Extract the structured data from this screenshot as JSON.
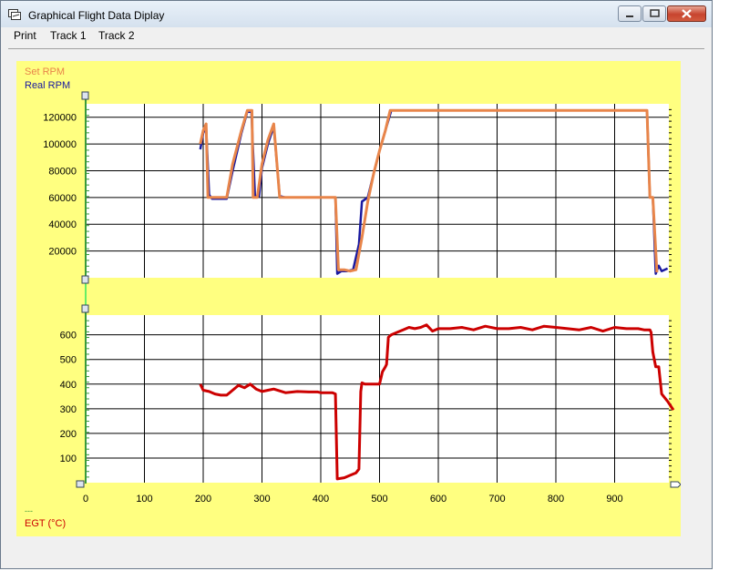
{
  "window": {
    "title": "Graphical Flight Data Diplay"
  },
  "menu": {
    "items": [
      "Print",
      "Track 1",
      "Track 2"
    ]
  },
  "legend": {
    "top": [
      {
        "label": "Set RPM",
        "color": "#e8854a"
      },
      {
        "label": "Real RPM",
        "color": "#1a1aa0"
      }
    ],
    "bottom": [
      {
        "label": "---",
        "color": "#3a9a3a"
      },
      {
        "label": "EGT (°C)",
        "color": "#cc0000"
      }
    ]
  },
  "chart_data": [
    {
      "type": "line",
      "x_range": [
        0,
        1000
      ],
      "ylim": [
        0,
        130000
      ],
      "y_ticks": [
        20000,
        40000,
        60000,
        80000,
        100000,
        120000
      ],
      "grid": true,
      "series": [
        {
          "name": "Set RPM",
          "color": "#e8854a",
          "x": [
            195,
            200,
            205,
            208,
            212,
            230,
            240,
            250,
            265,
            275,
            280,
            283,
            285,
            292,
            300,
            310,
            320,
            330,
            340,
            350,
            360,
            370,
            420,
            425,
            430,
            440,
            450,
            460,
            470,
            480,
            490,
            500,
            510,
            518,
            525,
            540,
            600,
            700,
            800,
            900,
            950,
            955,
            960,
            965,
            972
          ],
          "y": [
            100000,
            110000,
            115000,
            60000,
            60000,
            60000,
            60000,
            85000,
            110000,
            125000,
            125000,
            125000,
            60000,
            60000,
            85000,
            103000,
            115000,
            60000,
            60000,
            60000,
            60000,
            60000,
            60000,
            60000,
            6000,
            6000,
            5000,
            6000,
            30000,
            57000,
            78000,
            95000,
            110000,
            125000,
            125000,
            125000,
            125000,
            125000,
            125000,
            125000,
            125000,
            125000,
            60000,
            60000,
            4000
          ]
        },
        {
          "name": "Real RPM",
          "color": "#1a1aa0",
          "x": [
            195,
            200,
            205,
            210,
            215,
            230,
            240,
            250,
            265,
            275,
            282,
            288,
            295,
            300,
            310,
            320,
            330,
            340,
            350,
            360,
            370,
            420,
            425,
            428,
            435,
            445,
            455,
            465,
            470,
            480,
            490,
            500,
            510,
            520,
            540,
            600,
            700,
            800,
            900,
            955,
            960,
            965,
            970,
            975,
            980,
            990
          ],
          "y": [
            96000,
            108000,
            113000,
            62000,
            59000,
            59000,
            59000,
            80000,
            108000,
            124000,
            124000,
            61000,
            61000,
            82000,
            100000,
            113000,
            61000,
            60000,
            60000,
            60000,
            60000,
            60000,
            60000,
            3000,
            5000,
            5000,
            6000,
            25000,
            57000,
            60000,
            78000,
            95000,
            110000,
            125000,
            125000,
            125000,
            125000,
            125000,
            125000,
            125000,
            60000,
            60000,
            3000,
            9000,
            5000,
            7000
          ]
        }
      ]
    },
    {
      "type": "line",
      "x_range": [
        0,
        1000
      ],
      "ylim": [
        0,
        680
      ],
      "x_ticks": [
        0,
        100,
        200,
        300,
        400,
        500,
        600,
        700,
        800,
        900
      ],
      "y_ticks": [
        100,
        200,
        300,
        400,
        500,
        600
      ],
      "grid": true,
      "series": [
        {
          "name": "EGT (°C)",
          "color": "#cc0000",
          "x": [
            195,
            200,
            210,
            220,
            230,
            240,
            250,
            260,
            270,
            280,
            290,
            300,
            310,
            320,
            340,
            360,
            380,
            395,
            400,
            410,
            420,
            425,
            428,
            440,
            450,
            460,
            465,
            468,
            470,
            475,
            490,
            500,
            505,
            510,
            512,
            515,
            520,
            530,
            540,
            550,
            560,
            570,
            580,
            590,
            600,
            620,
            640,
            660,
            680,
            700,
            720,
            740,
            760,
            780,
            800,
            820,
            840,
            860,
            880,
            900,
            920,
            940,
            950,
            960,
            962,
            965,
            970,
            975,
            980,
            990,
            1000
          ],
          "y": [
            400,
            375,
            370,
            360,
            355,
            355,
            375,
            395,
            385,
            400,
            380,
            370,
            375,
            380,
            365,
            370,
            368,
            368,
            365,
            365,
            365,
            360,
            15,
            20,
            30,
            40,
            55,
            370,
            405,
            400,
            400,
            400,
            450,
            470,
            480,
            590,
            600,
            610,
            620,
            630,
            625,
            630,
            640,
            615,
            625,
            625,
            630,
            620,
            635,
            625,
            625,
            630,
            620,
            635,
            630,
            625,
            620,
            630,
            615,
            630,
            625,
            625,
            620,
            620,
            610,
            530,
            470,
            470,
            360,
            330,
            295
          ]
        }
      ]
    }
  ]
}
